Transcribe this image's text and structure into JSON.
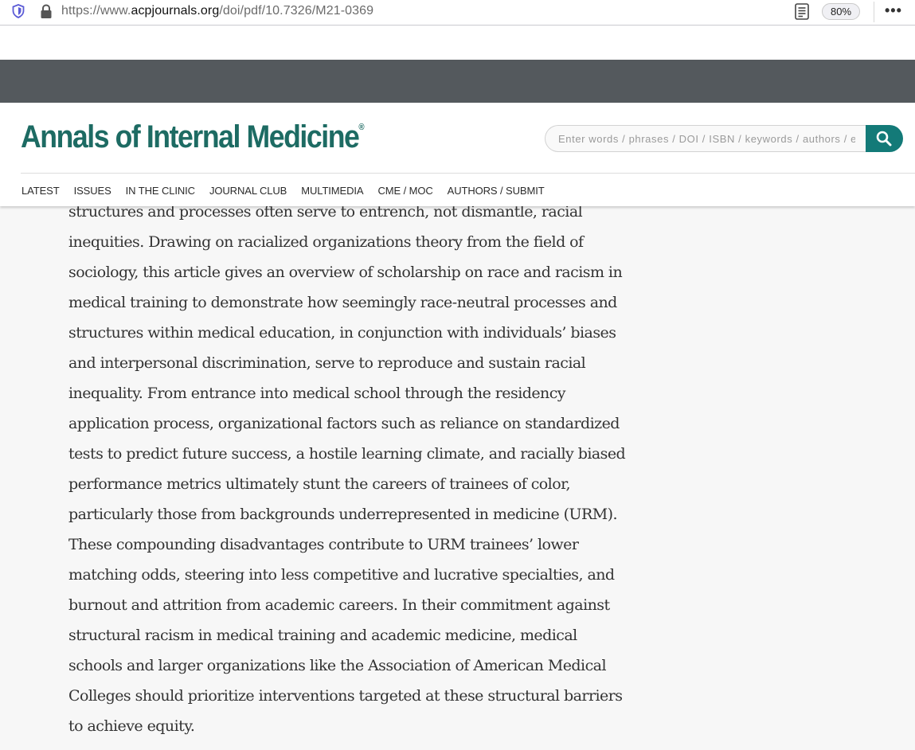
{
  "browser": {
    "url_prefix": "https://www.",
    "url_domain": "acpjournals.org",
    "url_path": "/doi/pdf/10.7326/M21-0369",
    "zoom": "80%",
    "more_label": "•••"
  },
  "site": {
    "logo_text": "Annals of Internal Medicine",
    "logo_mark": "®",
    "search_placeholder": "Enter words / phrases / DOI / ISBN / keywords / authors / etc",
    "brand_color": "#1d6b63",
    "search_button_color": "#137a78",
    "nav": [
      {
        "label": "LATEST"
      },
      {
        "label": "ISSUES"
      },
      {
        "label": "IN THE CLINIC"
      },
      {
        "label": "JOURNAL CLUB"
      },
      {
        "label": "MULTIMEDIA"
      },
      {
        "label": "CME / MOC"
      },
      {
        "label": "AUTHORS / SUBMIT"
      }
    ]
  },
  "article": {
    "lines": [
      "structures and processes often serve to entrench, not dismantle, racial",
      "inequities. Drawing on racialized organizations theory from the field of",
      "sociology, this article gives an overview of scholarship on race and racism in",
      "medical training to demonstrate how seemingly race-neutral processes and",
      "structures within medical education, in conjunction with individuals’ biases",
      "and interpersonal discrimination, serve to reproduce and sustain racial",
      "inequality. From entrance into medical school through the residency",
      "application process, organizational factors such as reliance on standardized",
      "tests to predict future success, a hostile learning climate, and racially biased",
      "performance metrics ultimately stunt the careers of trainees of color,",
      "particularly those from backgrounds underrepresented in medicine (URM).",
      "These compounding disadvantages contribute to URM trainees’ lower",
      "matching odds, steering into less competitive and lucrative specialties, and",
      "burnout and attrition from academic careers. In their commitment against",
      "structural racism in medical training and academic medicine, medical",
      "schools and larger organizations like the Association of American Medical",
      "Colleges should prioritize interventions targeted at these structural barriers",
      "to achieve equity."
    ]
  }
}
